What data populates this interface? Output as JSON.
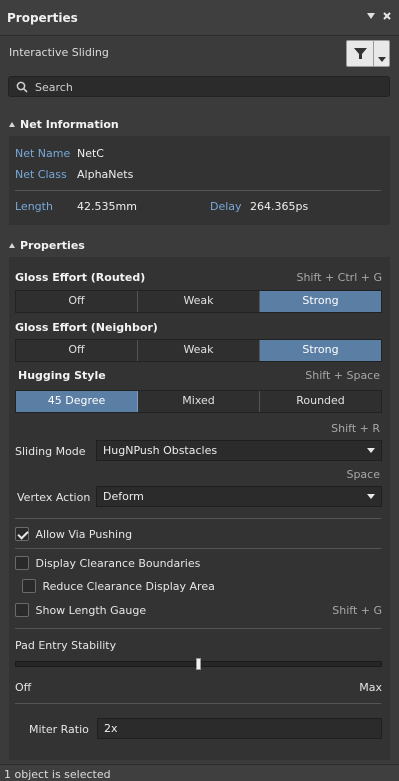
{
  "window": {
    "title": "Properties",
    "pin_icon": "pin-icon",
    "close_icon": "close-icon"
  },
  "mode": {
    "label": "Interactive Sliding",
    "filter_icon": "filter-icon"
  },
  "search": {
    "placeholder": "Search",
    "icon": "search-icon"
  },
  "net_info": {
    "heading": "Net Information",
    "net_name_label": "Net Name",
    "net_name_value": "NetC",
    "net_class_label": "Net Class",
    "net_class_value": "AlphaNets",
    "length_label": "Length",
    "length_value": "42.535mm",
    "delay_label": "Delay",
    "delay_value": "264.365ps"
  },
  "properties": {
    "heading": "Properties",
    "gloss_routed": {
      "label": "Gloss Effort (Routed)",
      "hotkey": "Shift + Ctrl + G",
      "options": [
        "Off",
        "Weak",
        "Strong"
      ],
      "selected": "Strong"
    },
    "gloss_neighbor": {
      "label": "Gloss Effort (Neighbor)",
      "options": [
        "Off",
        "Weak",
        "Strong"
      ],
      "selected": "Strong"
    },
    "hugging": {
      "label": "Hugging Style",
      "hotkey": "Shift + Space",
      "options": [
        "45 Degree",
        "Mixed",
        "Rounded"
      ],
      "selected": "45 Degree"
    },
    "sliding_mode": {
      "hotkey": "Shift + R",
      "label": "Sliding Mode",
      "value": "HugNPush Obstacles"
    },
    "vertex_action": {
      "hotkey": "Space",
      "label": "Vertex Action",
      "value": "Deform"
    },
    "allow_via_pushing": {
      "label": "Allow Via Pushing",
      "checked": true
    },
    "display_clearance": {
      "label": "Display Clearance Boundaries",
      "checked": false
    },
    "reduce_clearance": {
      "label": "Reduce Clearance Display Area",
      "checked": false
    },
    "show_length_gauge": {
      "label": "Show Length Gauge",
      "checked": false,
      "hotkey": "Shift + G"
    },
    "pad_entry": {
      "label": "Pad Entry Stability",
      "min_label": "Off",
      "max_label": "Max",
      "level": 0.5
    },
    "miter_ratio": {
      "label": "Miter Ratio",
      "value": "2x"
    }
  },
  "status": {
    "text": "1 object is selected"
  },
  "colors": {
    "accent": "#5b7ea4",
    "label_blue": "#77a8d8",
    "background": "#3b3b3b"
  }
}
